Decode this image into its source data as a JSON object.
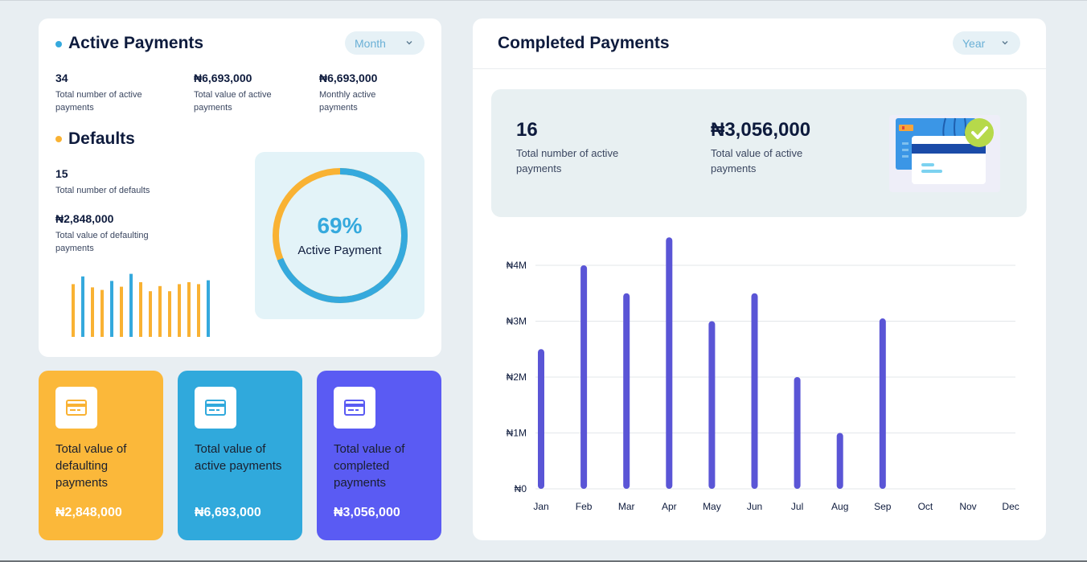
{
  "active_payments": {
    "title": "Active Payments",
    "period_select": "Month",
    "stats": [
      {
        "value": "34",
        "label": "Total number of active payments"
      },
      {
        "value": "₦6,693,000",
        "label": "Total value of active payments"
      },
      {
        "value": "₦6,693,000",
        "label": "Monthly active payments"
      }
    ]
  },
  "defaults": {
    "title": "Defaults",
    "count": {
      "value": "15",
      "label": "Total number of defaults"
    },
    "amount": {
      "value": "₦2,848,000",
      "label": "Total value of defaulting payments"
    }
  },
  "donut": {
    "percent_text": "69%",
    "label": "Active Payment",
    "percent": 69,
    "active_color": "#35a9dd",
    "default_color": "#f9b233"
  },
  "mini_bars": [
    {
      "color": "#f9b233",
      "value": 0.82
    },
    {
      "color": "#35a9dd",
      "value": 0.94
    },
    {
      "color": "#f9b233",
      "value": 0.77
    },
    {
      "color": "#f9b233",
      "value": 0.73
    },
    {
      "color": "#35a9dd",
      "value": 0.87
    },
    {
      "color": "#f9b233",
      "value": 0.78
    },
    {
      "color": "#35a9dd",
      "value": 0.98
    },
    {
      "color": "#f9b233",
      "value": 0.85
    },
    {
      "color": "#f9b233",
      "value": 0.71
    },
    {
      "color": "#f9b233",
      "value": 0.79
    },
    {
      "color": "#f9b233",
      "value": 0.71
    },
    {
      "color": "#f9b233",
      "value": 0.82
    },
    {
      "color": "#f9b233",
      "value": 0.85
    },
    {
      "color": "#f9b233",
      "value": 0.82
    },
    {
      "color": "#35a9dd",
      "value": 0.88
    }
  ],
  "tiles": [
    {
      "label": "Total value of defaulting payments",
      "value": "₦2,848,000",
      "color": "#fbb83a",
      "icon": "credit-card-icon",
      "icon_color": "#f9b233"
    },
    {
      "label": "Total value of active payments",
      "value": "₦6,693,000",
      "color": "#30a9dc",
      "icon": "credit-card-icon",
      "icon_color": "#30a9dc"
    },
    {
      "label": "Total value of completed payments",
      "value": "₦3,056,000",
      "color": "#5a5bf3",
      "icon": "credit-card-icon",
      "icon_color": "#5a5bf3"
    }
  ],
  "completed_payments": {
    "title": "Completed Payments",
    "period_select": "Year",
    "stats": [
      {
        "value": "16",
        "label": "Total number of active payments"
      },
      {
        "value": "₦3,056,000",
        "label": "Total value of active payments"
      }
    ]
  },
  "chart_data": {
    "type": "bar",
    "categories": [
      "Jan",
      "Feb",
      "Mar",
      "Apr",
      "May",
      "Jun",
      "Jul",
      "Aug",
      "Sep",
      "Oct",
      "Nov",
      "Dec"
    ],
    "values": [
      2500000,
      4000000,
      3500000,
      4500000,
      3000000,
      3500000,
      2000000,
      1000000,
      3050000,
      0,
      0,
      0
    ],
    "ylim": [
      0,
      4000000
    ],
    "yticks": [
      0,
      1000000,
      2000000,
      3000000,
      4000000
    ],
    "ytick_labels": [
      "₦0",
      "₦1M",
      "₦2M",
      "₦3M",
      "₦4M"
    ],
    "bar_color": "#5a55d6",
    "grid": true
  }
}
